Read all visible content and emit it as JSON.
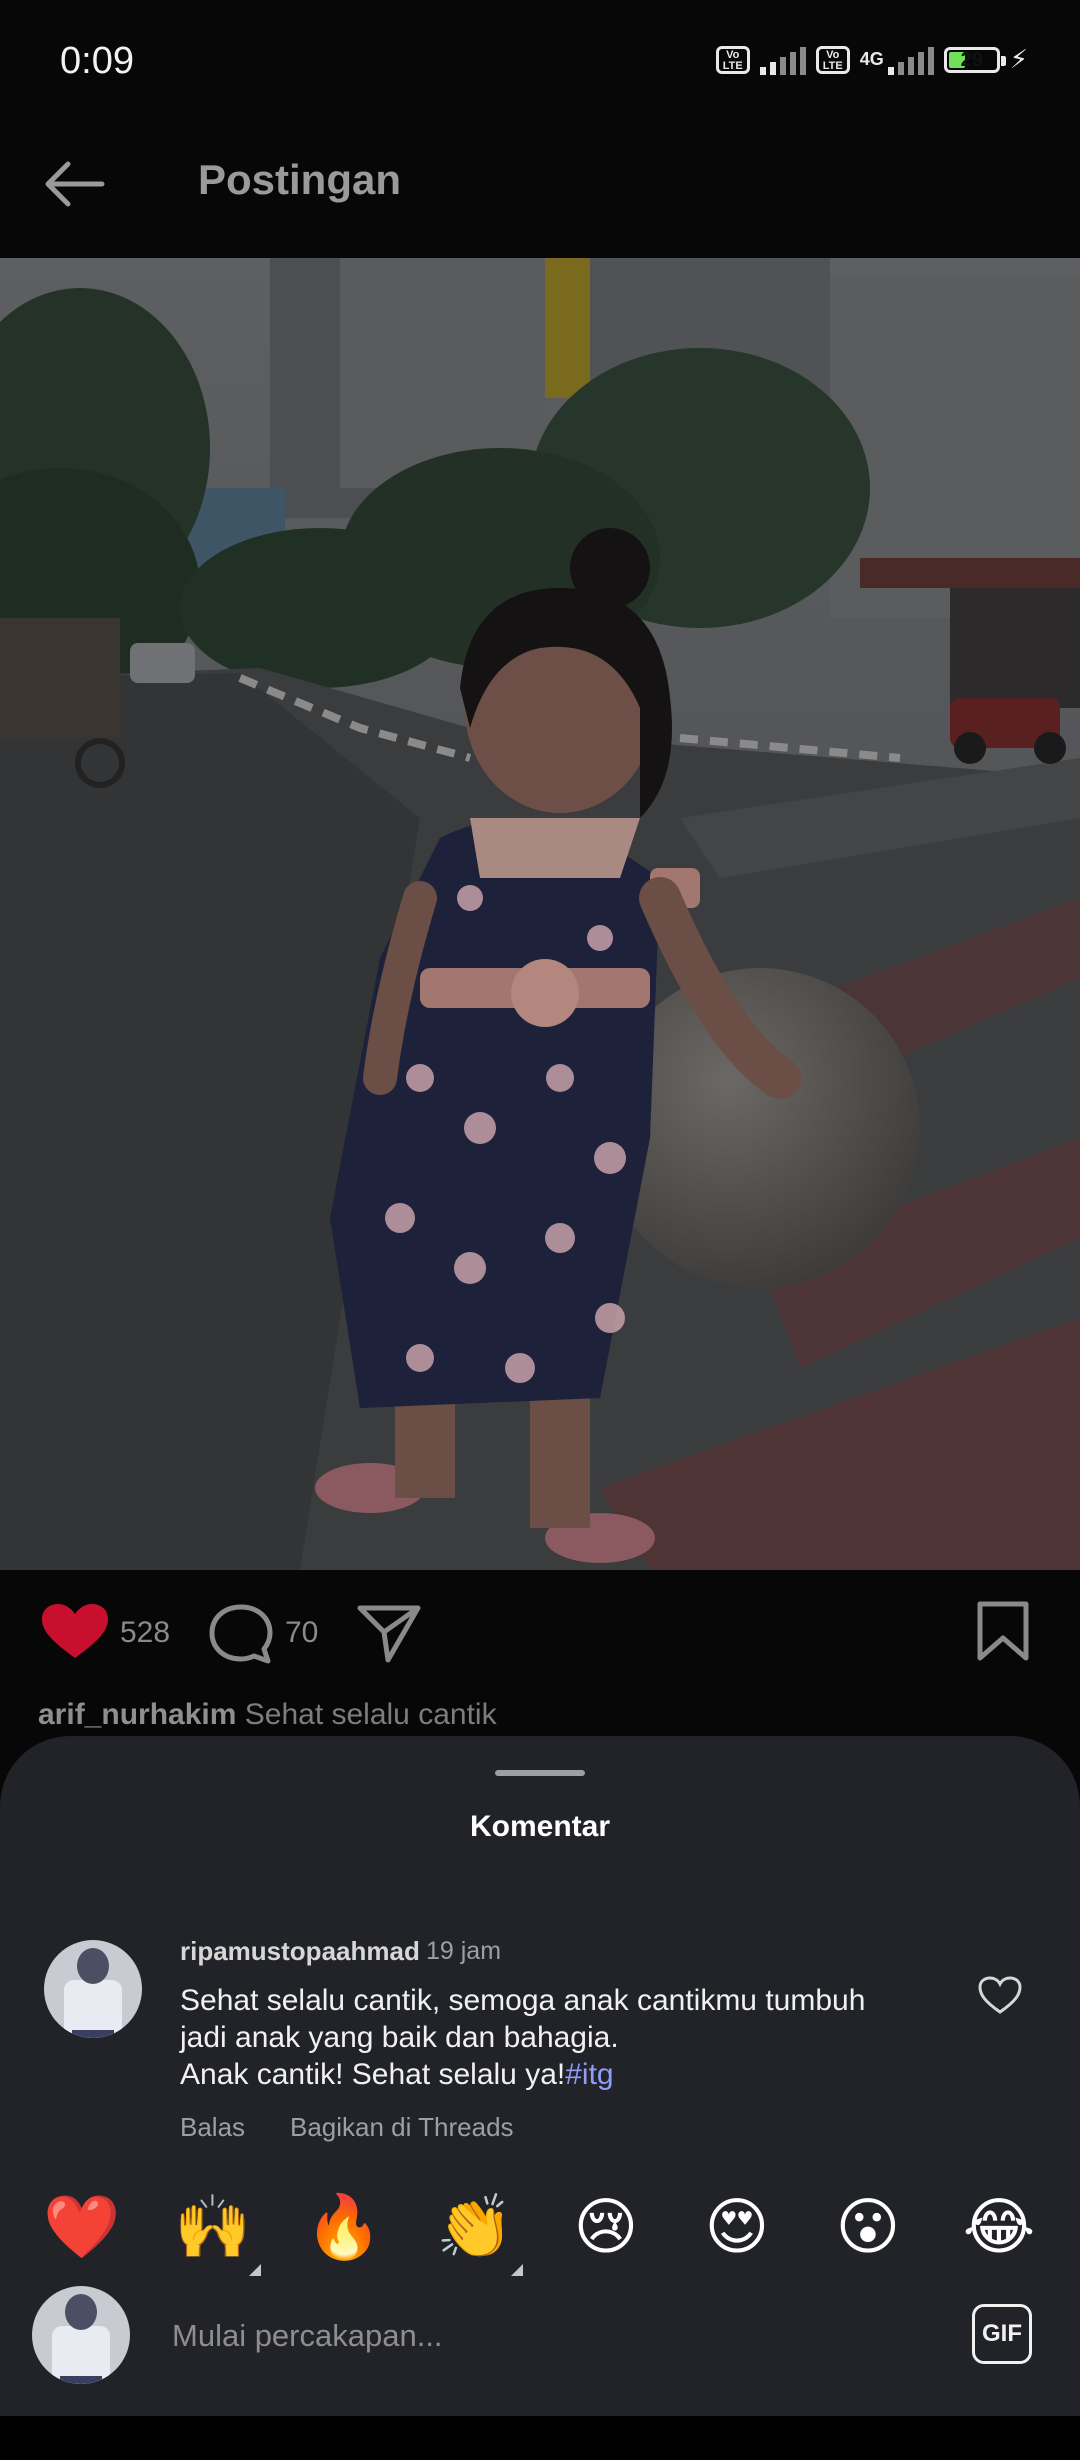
{
  "status_bar": {
    "time": "0:09",
    "volte_label": "Vo LTE",
    "network_label": "4G",
    "battery_level": "29"
  },
  "header": {
    "title": "Postingan",
    "back_icon": "arrow-left-icon"
  },
  "post": {
    "likes": "528",
    "comments": "70",
    "caption_user": "arif_nurhakim",
    "caption_text": "Sehat selalu cantik",
    "icons": [
      "heart-filled-icon",
      "comment-bubble-icon",
      "send-icon",
      "bookmark-icon"
    ],
    "like_color": "#c8102e"
  },
  "comments_sheet": {
    "title": "Komentar",
    "comment": {
      "username": "ripamustopaahmad",
      "time": "19 jam",
      "text_line1": "Sehat selalu cantik, semoga anak cantikmu tumbuh",
      "text_line2": "jadi anak yang baik dan bahagia.",
      "text_line3": "Anak cantik!  Sehat selalu ya!",
      "hashtag": "#itg",
      "reply_label": "Balas",
      "share_threads_label": "Bagikan di Threads"
    },
    "emoji_reactions": [
      "❤️",
      "🙌",
      "🔥",
      "👏",
      "😢",
      "😍",
      "😮",
      "😂"
    ],
    "composer": {
      "placeholder": "Mulai percakapan...",
      "gif_label": "GIF"
    }
  }
}
